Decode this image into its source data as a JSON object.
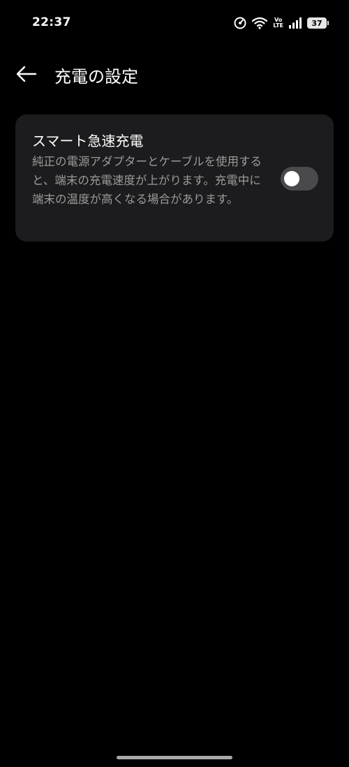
{
  "status_bar": {
    "time": "22:37",
    "icons": [
      "data-saver-icon",
      "wifi-icon",
      "volte-icon",
      "signal-icon",
      "battery-icon"
    ],
    "volte_top": "Vo",
    "volte_bottom": "LTE",
    "battery_level": "37"
  },
  "header": {
    "back_icon": "arrow-left-icon",
    "title": "充電の設定"
  },
  "settings": [
    {
      "title": "スマート急速充電",
      "description": "純正の電源アダプターとケーブルを使用すると、端末の充電速度が上がります。充電中に端末の温度が高くなる場合があります。",
      "toggle_on": false
    }
  ],
  "colors": {
    "background": "#000000",
    "card": "#1c1c1e",
    "text_primary": "#ffffff",
    "text_secondary": "#9a9a9a",
    "toggle_off_track": "#4a4a4c"
  }
}
